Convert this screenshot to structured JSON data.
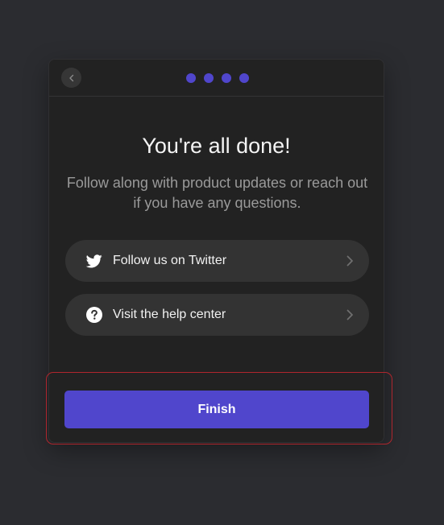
{
  "onboarding": {
    "header": {
      "back_icon": "chevron-left-icon",
      "steps": [
        {
          "state": "complete"
        },
        {
          "state": "complete"
        },
        {
          "state": "complete"
        },
        {
          "state": "complete"
        }
      ],
      "step_color": "#5046cc"
    },
    "title": "You're all done!",
    "subtitle": "Follow along with product updates or reach out if you have any questions.",
    "links": [
      {
        "label": "Follow us on Twitter",
        "icon": "twitter-icon"
      },
      {
        "label": "Visit the help center",
        "icon": "question-circle-icon"
      }
    ],
    "finish_label": "Finish"
  },
  "colors": {
    "background": "#2b2c30",
    "modal": "#222222",
    "accent": "#5046cc",
    "row": "#333333",
    "highlight_border": "#b0262d"
  }
}
